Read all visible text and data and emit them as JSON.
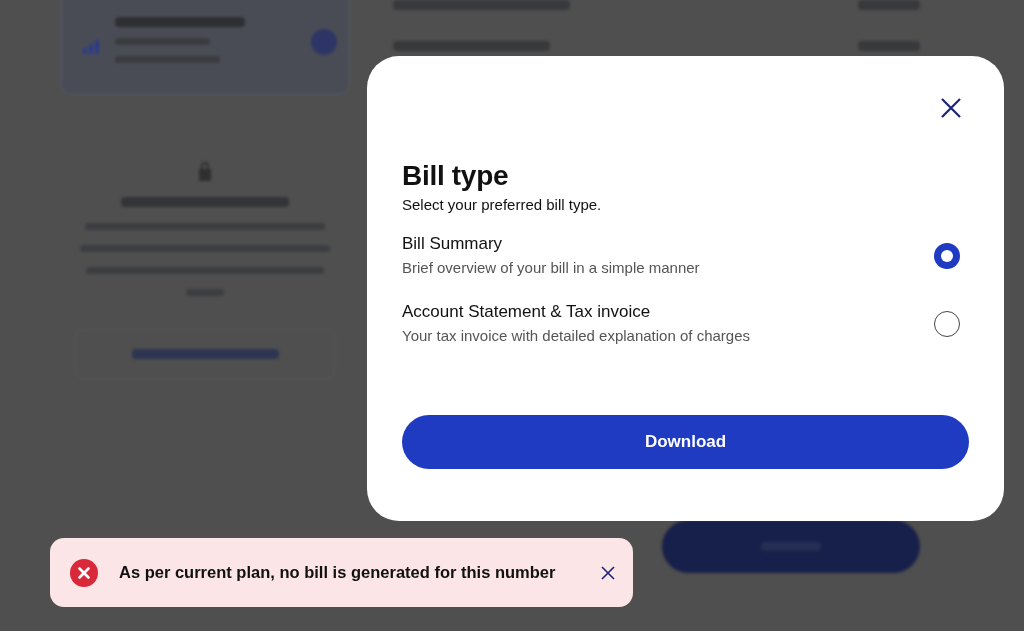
{
  "dialog": {
    "title": "Bill type",
    "subtitle": "Select your preferred bill type.",
    "options": [
      {
        "title": "Bill Summary",
        "description": "Brief overview of your bill in a simple manner",
        "selected": true
      },
      {
        "title": "Account Statement & Tax invoice",
        "description": "Your tax invoice with detailed explanation of charges",
        "selected": false
      }
    ],
    "button": "Download"
  },
  "toast": {
    "kind": "error",
    "message": "As per current plan, no bill is generated for this number"
  }
}
